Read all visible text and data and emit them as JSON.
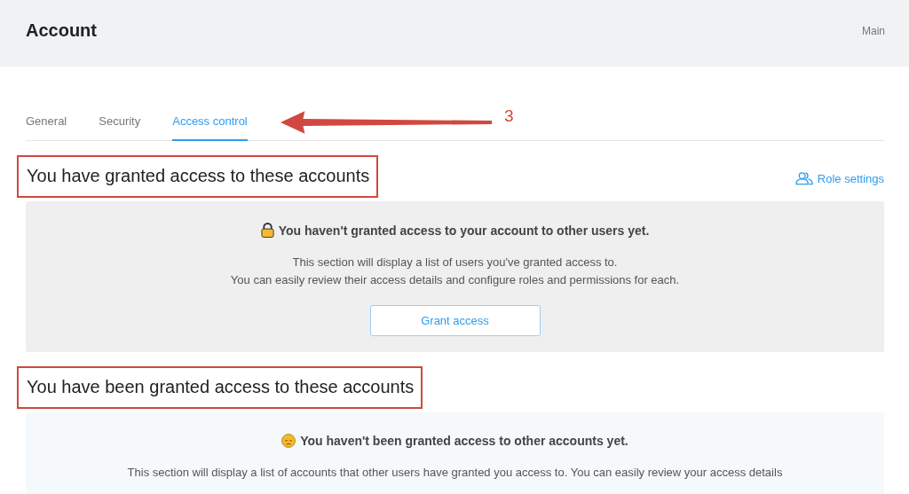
{
  "header": {
    "title": "Account",
    "breadcrumb": "Main"
  },
  "tabs": [
    {
      "label": "General",
      "selected": false
    },
    {
      "label": "Security",
      "selected": false
    },
    {
      "label": "Access control",
      "selected": true
    }
  ],
  "annotation": {
    "label": "3"
  },
  "sections": [
    {
      "kind": "outgoing",
      "heading": "You have granted access to these accounts",
      "highlighted": true,
      "link": "Role settings",
      "panel": {
        "title": "You haven't granted access to your account to other users yet.",
        "lines": [
          "This section will display a list of users you've granted access to.",
          "You can easily review their access details and configure roles and permissions for each."
        ],
        "button": "Grant access"
      }
    },
    {
      "kind": "incoming",
      "heading": "You have been granted access to these accounts",
      "highlighted": true,
      "panel": {
        "title": "You haven't been granted access to other accounts yet.",
        "lines": [
          "This section will display a list of accounts that other users have granted you access to. You can easily review your access details"
        ]
      }
    }
  ]
}
